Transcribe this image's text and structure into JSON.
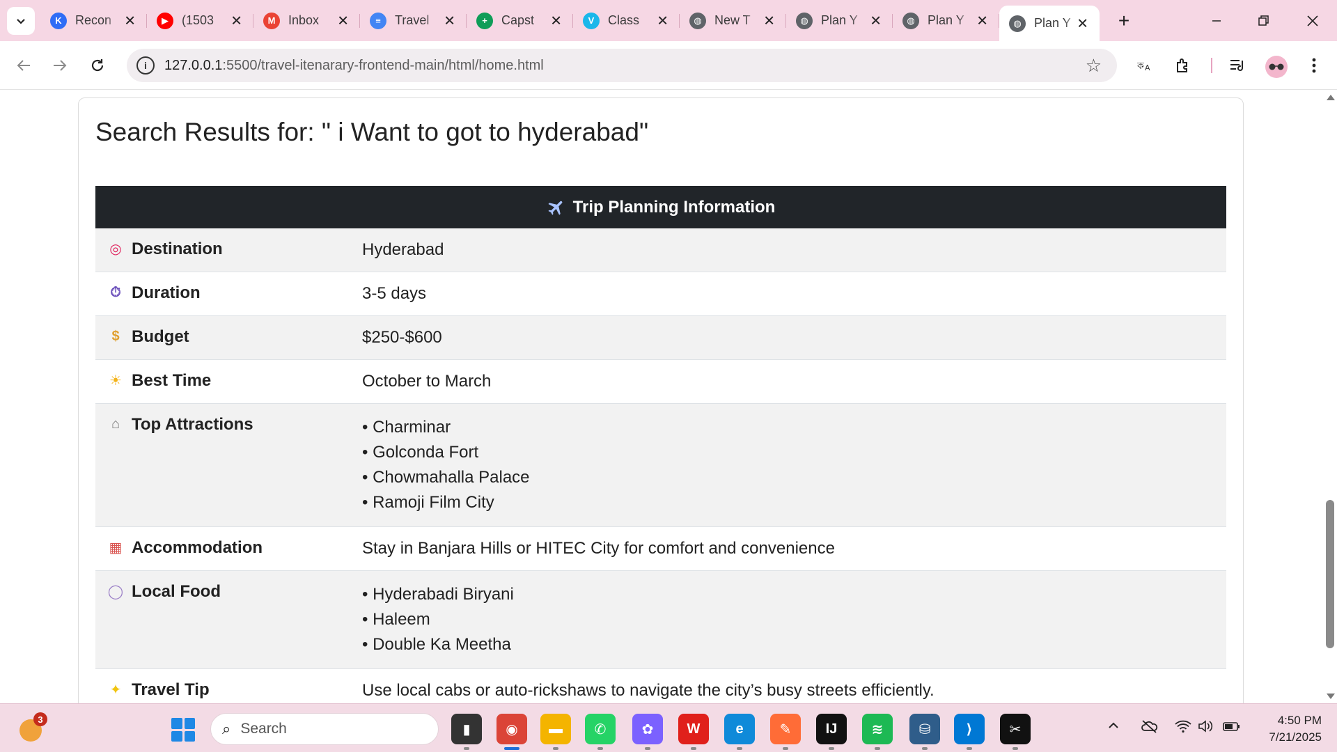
{
  "browser": {
    "tabs": [
      {
        "title": "Recon",
        "favicon": "k-icon",
        "color": "#2f6df6",
        "glyph": "K"
      },
      {
        "title": "(1503",
        "favicon": "youtube-icon",
        "color": "#ff0000",
        "glyph": "▶"
      },
      {
        "title": "Inbox",
        "favicon": "gmail-icon",
        "color": "#ea4335",
        "glyph": "M"
      },
      {
        "title": "Travel",
        "favicon": "docs-icon",
        "color": "#4285f4",
        "glyph": "≡"
      },
      {
        "title": "Capst",
        "favicon": "sheets-icon",
        "color": "#0f9d58",
        "glyph": "+"
      },
      {
        "title": "Class",
        "favicon": "vimeo-icon",
        "color": "#1ab7ea",
        "glyph": "V"
      },
      {
        "title": "New T",
        "favicon": "globe-icon",
        "color": "#5f6368",
        "glyph": "◍"
      },
      {
        "title": "Plan Y",
        "favicon": "globe-icon",
        "color": "#5f6368",
        "glyph": "◍"
      },
      {
        "title": "Plan Y",
        "favicon": "globe-icon",
        "color": "#5f6368",
        "glyph": "◍"
      },
      {
        "title": "Plan Y",
        "favicon": "globe-icon",
        "color": "#5f6368",
        "glyph": "◍",
        "active": true
      }
    ],
    "url_host": "127.0.0.1",
    "url_path": ":5500/travel-itenarary-frontend-main/html/home.html"
  },
  "page": {
    "results_title": "Search Results for: \" i Want to got to hyderabad\"",
    "table_header": "Trip Planning Information",
    "rows": [
      {
        "label": "Destination",
        "icon": "target-icon",
        "glyph": "◎",
        "icon_color": "#e0245e",
        "values": [
          "Hyderabad"
        ]
      },
      {
        "label": "Duration",
        "icon": "stopwatch-icon",
        "glyph": "⏱",
        "icon_color": "#6b4fbb",
        "values": [
          "3-5 days"
        ]
      },
      {
        "label": "Budget",
        "icon": "money-bag-icon",
        "glyph": "$",
        "icon_color": "#e0a030",
        "values": [
          "$250-$600"
        ]
      },
      {
        "label": "Best Time",
        "icon": "sun-cloud-icon",
        "glyph": "☀",
        "icon_color": "#f3b31a",
        "values": [
          "October to March"
        ]
      },
      {
        "label": "Top Attractions",
        "icon": "classical-building-icon",
        "glyph": "⌂",
        "icon_color": "#777777",
        "values": [
          "• Charminar",
          "• Golconda Fort",
          "• Chowmahalla Palace",
          "• Ramoji Film City"
        ]
      },
      {
        "label": "Accommodation",
        "icon": "hotel-icon",
        "glyph": "▦",
        "icon_color": "#d9534f",
        "values": [
          "Stay in Banjara Hills or HITEC City for comfort and convenience"
        ]
      },
      {
        "label": "Local Food",
        "icon": "plate-icon",
        "glyph": "◯",
        "icon_color": "#9b7fc7",
        "values": [
          "• Hyderabadi Biryani",
          "• Haleem",
          "• Double Ka Meetha"
        ]
      },
      {
        "label": "Travel Tip",
        "icon": "light-bulb-icon",
        "glyph": "✦",
        "icon_color": "#f1c40f",
        "values": [
          "Use local cabs or auto-rickshaws to navigate the city’s busy streets efficiently."
        ]
      }
    ]
  },
  "taskbar": {
    "weather_badge": "3",
    "search_label": "Search",
    "apps": [
      {
        "name": "task-view",
        "glyph": "▮",
        "color": "#333333"
      },
      {
        "name": "chrome",
        "glyph": "◉",
        "color": "#db4437",
        "active": true
      },
      {
        "name": "file-explorer",
        "glyph": "▬",
        "color": "#f4b400"
      },
      {
        "name": "whatsapp",
        "glyph": "✆",
        "color": "#25d366"
      },
      {
        "name": "copilot",
        "glyph": "✿",
        "color": "#7b61ff"
      },
      {
        "name": "wps-office",
        "glyph": "W",
        "color": "#e0201b"
      },
      {
        "name": "edge",
        "glyph": "e",
        "color": "#0f8ad9"
      },
      {
        "name": "postman",
        "glyph": "✎",
        "color": "#ff6c37"
      },
      {
        "name": "intellij",
        "glyph": "IJ",
        "color": "#111111"
      },
      {
        "name": "spotify",
        "glyph": "≋",
        "color": "#1db954"
      },
      {
        "name": "mysql-workbench",
        "glyph": "⛁",
        "color": "#2f5d8a"
      },
      {
        "name": "vscode",
        "glyph": "⟩",
        "color": "#0078d4"
      },
      {
        "name": "capcut",
        "glyph": "✂",
        "color": "#111111"
      }
    ],
    "time": "4:50 PM",
    "date": "7/21/2025"
  }
}
